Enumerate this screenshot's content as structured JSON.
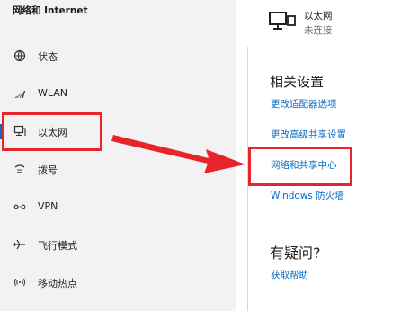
{
  "left_pane": {
    "title": "网络和 Internet",
    "items": [
      {
        "label": "状态",
        "icon": "status-globe-icon"
      },
      {
        "label": "WLAN",
        "icon": "wifi-icon"
      },
      {
        "label": "以太网",
        "icon": "ethernet-icon",
        "selected": true
      },
      {
        "label": "拨号",
        "icon": "dialup-icon"
      },
      {
        "label": "VPN",
        "icon": "vpn-icon"
      },
      {
        "label": "飞行模式",
        "icon": "airplane-icon"
      },
      {
        "label": "移动热点",
        "icon": "hotspot-icon"
      }
    ]
  },
  "right_pane": {
    "connection": {
      "name": "以太网",
      "status": "未连接",
      "icon": "ethernet-monitor-icon"
    },
    "related_settings": {
      "title": "相关设置",
      "links": [
        "更改适配器选项",
        "更改高级共享设置",
        "网络和共享中心",
        "Windows 防火墙"
      ]
    },
    "help": {
      "title": "有疑问?",
      "link": "获取帮助"
    }
  },
  "colors": {
    "accent": "#0a6cc4",
    "annotation_red": "#e8242b",
    "left_bg": "#f2f2f2"
  }
}
